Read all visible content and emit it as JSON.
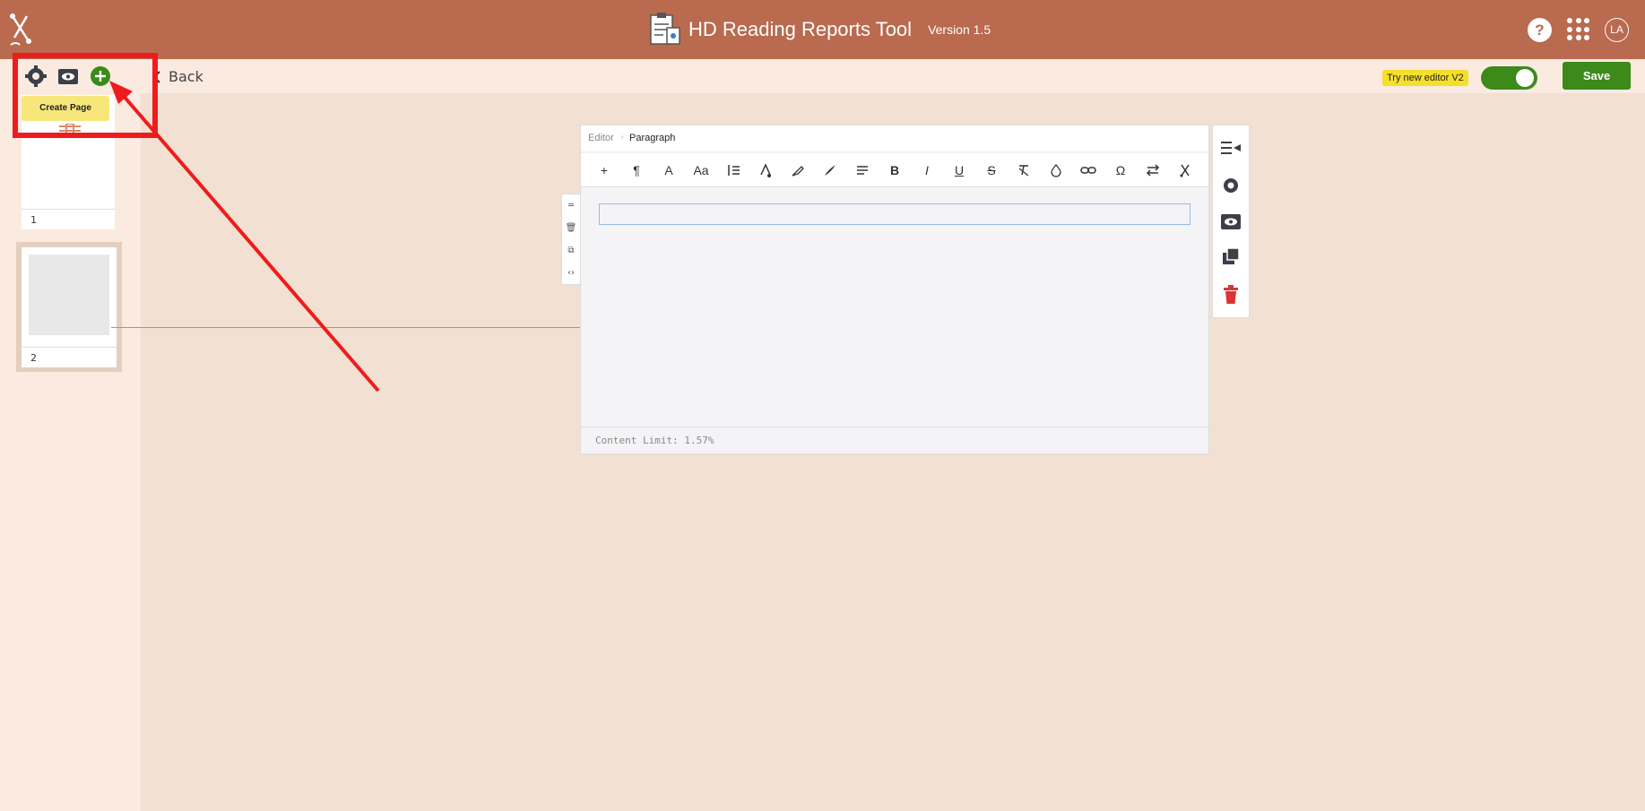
{
  "header": {
    "app_title": "HD Reading Reports Tool",
    "version": "Version 1.5",
    "help_label": "?",
    "avatar_initials": "LA"
  },
  "subbar": {
    "back_label": "Back",
    "try_editor_label": "Try new editor V2",
    "toggle_on": true,
    "save_label": "Save"
  },
  "left_panel": {
    "tooltip_label": "Create Page",
    "pages": [
      {
        "number": "1"
      },
      {
        "number": "2"
      }
    ]
  },
  "editor": {
    "breadcrumb_root": "Editor",
    "breadcrumb_sep": "›",
    "breadcrumb_current": "Paragraph",
    "toolbar": [
      "+",
      "¶",
      "A",
      "Aa",
      "line-height",
      "font-color",
      "highlight",
      "brush",
      "align",
      "B",
      "I",
      "U",
      "S",
      "clear-format",
      "drop",
      "link",
      "Ω",
      "swap",
      "scissors"
    ],
    "content_limit": "Content Limit: 1.57%"
  },
  "colors": {
    "header_bg": "#b96a4f",
    "accent_green": "#3c8a1a",
    "annotation_red": "#ee1c1c",
    "tooltip_yellow": "#f7e77a"
  }
}
